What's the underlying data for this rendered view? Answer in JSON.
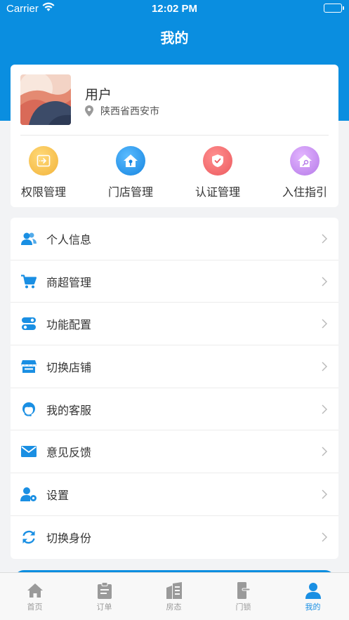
{
  "status_bar": {
    "carrier": "Carrier",
    "time": "12:02 PM"
  },
  "header": {
    "title": "我的",
    "background_color": "#0a8ee0"
  },
  "profile": {
    "name": "用户",
    "location": "陕西省西安市"
  },
  "quick_actions": [
    {
      "label": "权限管理",
      "icon": "permission-icon",
      "color": "#f7c142"
    },
    {
      "label": "门店管理",
      "icon": "store-home-icon",
      "color": "#2a9df0"
    },
    {
      "label": "认证管理",
      "icon": "shield-check-icon",
      "color": "#f06a6a"
    },
    {
      "label": "入住指引",
      "icon": "home-key-icon",
      "color": "#c98df0"
    }
  ],
  "menu": [
    {
      "label": "个人信息",
      "icon": "users-icon"
    },
    {
      "label": "商超管理",
      "icon": "cart-icon"
    },
    {
      "label": "功能配置",
      "icon": "toggle-config-icon"
    },
    {
      "label": "切换店铺",
      "icon": "storefront-icon"
    },
    {
      "label": "我的客服",
      "icon": "headset-agent-icon"
    },
    {
      "label": "意见反馈",
      "icon": "mail-icon"
    },
    {
      "label": "设置",
      "icon": "user-settings-icon"
    },
    {
      "label": "切换身份",
      "icon": "sync-icon"
    }
  ],
  "tabs": [
    {
      "label": "首页",
      "icon": "home-icon",
      "active": false
    },
    {
      "label": "订单",
      "icon": "clipboard-icon",
      "active": false
    },
    {
      "label": "房态",
      "icon": "building-icon",
      "active": false
    },
    {
      "label": "门锁",
      "icon": "door-lock-icon",
      "active": false
    },
    {
      "label": "我的",
      "icon": "person-icon",
      "active": true
    }
  ],
  "colors": {
    "accent": "#1a8fe3",
    "menu_icon": "#1a8fe3",
    "tab_inactive": "#9a9a9a"
  }
}
